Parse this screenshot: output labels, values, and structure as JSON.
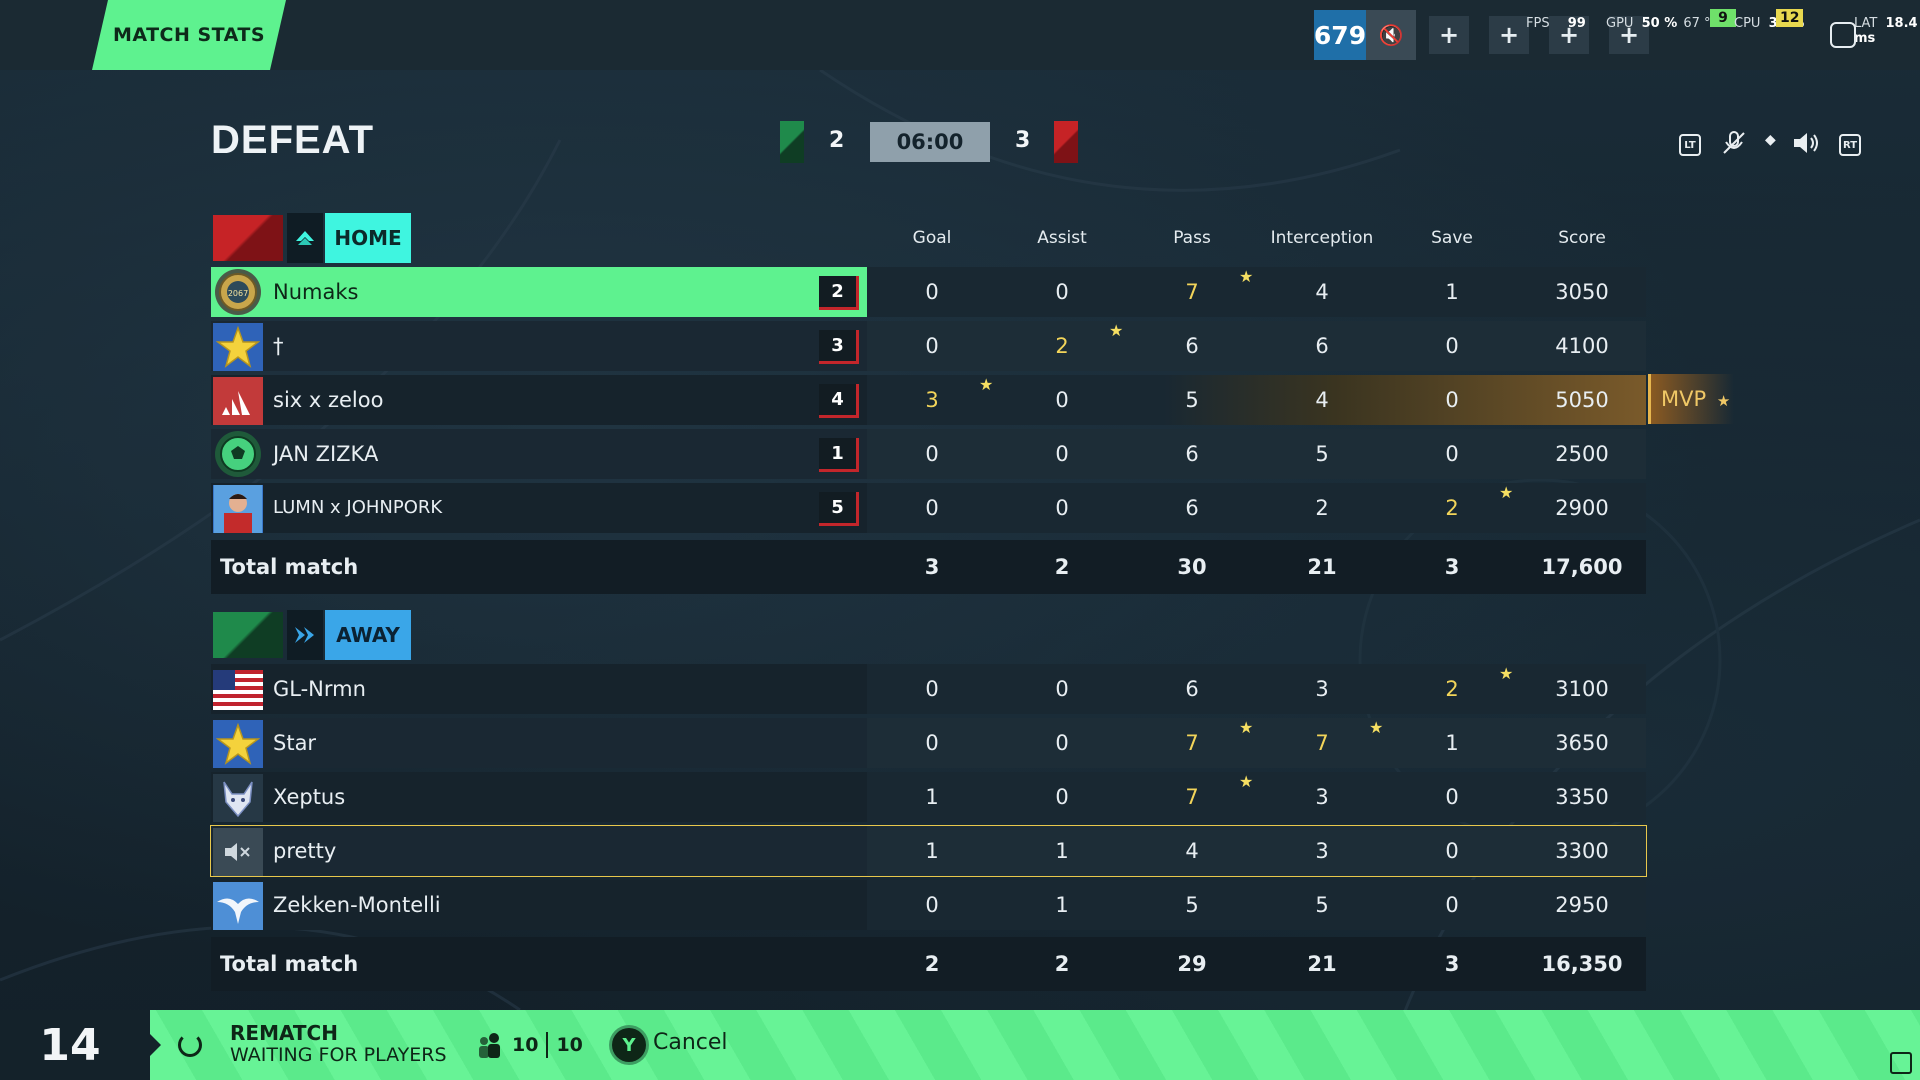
{
  "topbar": {
    "tab_label": "MATCH STATS",
    "hud_score": "679",
    "fps_label": "FPS",
    "fps_value": "99",
    "gpu_label": "GPU",
    "gpu_value": "50 %",
    "gpu_temp": "67 °C",
    "cpu_label": "CPU",
    "cpu_value": "39 %",
    "badge_a": "9",
    "badge_b": "12",
    "lat_label": "LAT",
    "lat_value": "18.4 ms"
  },
  "header": {
    "result": "DEFEAT",
    "home_score": "2",
    "timer": "06:00",
    "away_score": "3"
  },
  "columns": [
    "Goal",
    "Assist",
    "Pass",
    "Interception",
    "Save",
    "Score"
  ],
  "home": {
    "label": "HOME",
    "players": [
      {
        "name": "Numaks",
        "pos": "2",
        "goal": "0",
        "assist": "0",
        "pass": "7",
        "interception": "4",
        "save": "1",
        "score": "3050",
        "avatar": "badge-emblem-icon"
      },
      {
        "name": "†",
        "pos": "3",
        "goal": "0",
        "assist": "2",
        "pass": "6",
        "interception": "6",
        "save": "0",
        "score": "4100",
        "avatar": "star-icon"
      },
      {
        "name": "six x zeloo",
        "pos": "4",
        "goal": "3",
        "assist": "0",
        "pass": "5",
        "interception": "4",
        "save": "0",
        "score": "5050",
        "avatar": "brand-stripes-icon"
      },
      {
        "name": "JAN ZIZKA",
        "pos": "1",
        "goal": "0",
        "assist": "0",
        "pass": "6",
        "interception": "5",
        "save": "0",
        "score": "2500",
        "avatar": "soccer-ball-icon"
      },
      {
        "name": "LUMN x JOHNPORK",
        "pos": "5",
        "goal": "0",
        "assist": "0",
        "pass": "6",
        "interception": "2",
        "save": "2",
        "score": "2900",
        "avatar": "player-photo"
      }
    ],
    "total": {
      "label": "Total match",
      "goal": "3",
      "assist": "2",
      "pass": "30",
      "interception": "21",
      "save": "3",
      "score": "17,600"
    },
    "mvp": "MVP"
  },
  "away": {
    "label": "AWAY",
    "players": [
      {
        "name": "GL-Nrmn",
        "goal": "0",
        "assist": "0",
        "pass": "6",
        "interception": "3",
        "save": "2",
        "score": "3100",
        "avatar": "us-flag-icon"
      },
      {
        "name": "Star",
        "goal": "0",
        "assist": "0",
        "pass": "7",
        "interception": "7",
        "save": "1",
        "score": "3650",
        "avatar": "star-icon"
      },
      {
        "name": "Xeptus",
        "goal": "1",
        "assist": "0",
        "pass": "7",
        "interception": "3",
        "save": "0",
        "score": "3350",
        "avatar": "wolf-icon"
      },
      {
        "name": "pretty",
        "goal": "1",
        "assist": "1",
        "pass": "4",
        "interception": "3",
        "save": "0",
        "score": "3300",
        "avatar": "muted-speaker-icon"
      },
      {
        "name": "Zekken-Montelli",
        "goal": "0",
        "assist": "1",
        "pass": "5",
        "interception": "5",
        "save": "0",
        "score": "2950",
        "avatar": "eagle-icon"
      }
    ],
    "total": {
      "label": "Total match",
      "goal": "2",
      "assist": "2",
      "pass": "29",
      "interception": "21",
      "save": "3",
      "score": "16,350"
    }
  },
  "bottom": {
    "countdown": "14",
    "rematch_title": "REMATCH",
    "rematch_status": "WAITING FOR PLAYERS",
    "players_ready": "10",
    "players_total": "10",
    "button_key": "Y",
    "cancel_label": "Cancel"
  },
  "colors": {
    "accent_green": "#5ef28f",
    "home_label": "#3ff5e0",
    "away_label": "#3aa6e8",
    "highlight_gold": "#f3d55a",
    "red_team": "#c62326",
    "green_team": "#1f8a4b"
  }
}
